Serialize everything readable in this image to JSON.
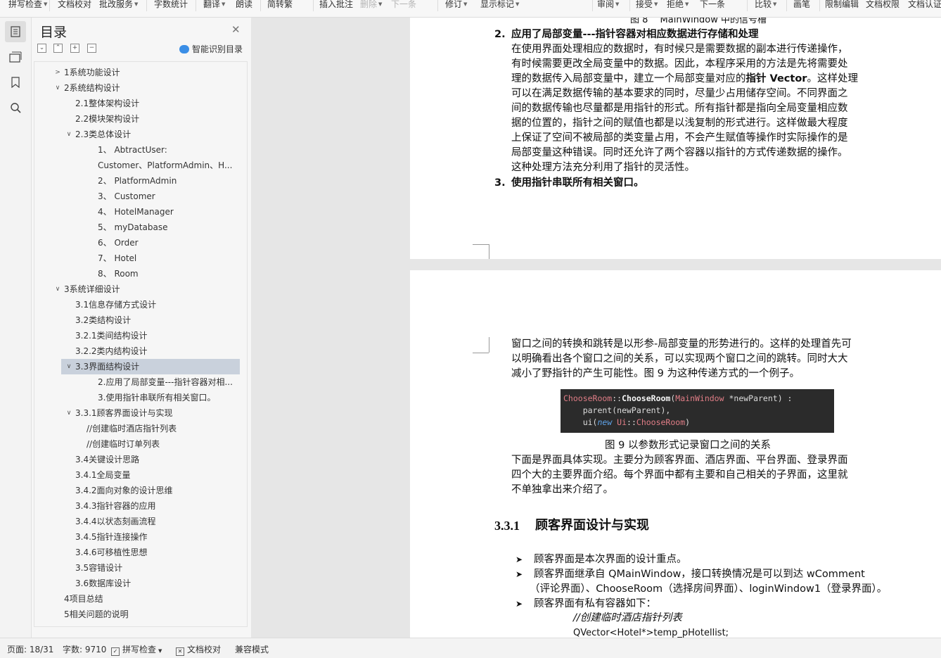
{
  "toolbar": {
    "items": [
      {
        "label": "拼写检查",
        "caret": true
      },
      {
        "label": "文档校对",
        "caret": false
      },
      {
        "label": "批改服务",
        "caret": true
      },
      {
        "label": "字数统计",
        "caret": false
      },
      {
        "label": "翻译",
        "caret": true
      },
      {
        "label": "朗读",
        "caret": false
      },
      {
        "label": "简转繁",
        "caret": false
      },
      {
        "label": "插入批注",
        "caret": false
      },
      {
        "label": "删除",
        "caret": true
      },
      {
        "label": "下一条",
        "caret": false
      },
      {
        "label": "修订",
        "caret": true
      },
      {
        "label": "显示标记",
        "caret": true
      },
      {
        "label": "审阅",
        "caret": true
      },
      {
        "label": "接受",
        "caret": true
      },
      {
        "label": "拒绝",
        "caret": true
      },
      {
        "label": "下一条",
        "caret": false
      },
      {
        "label": "比较",
        "caret": true
      },
      {
        "label": "画笔",
        "caret": false
      },
      {
        "label": "限制编辑",
        "caret": false
      },
      {
        "label": "文档权限",
        "caret": false
      },
      {
        "label": "文档认证",
        "caret": false
      }
    ]
  },
  "toc": {
    "title": "目录",
    "smart_label": "智能识别目录",
    "items": [
      {
        "label": "1系统功能设计",
        "arrow": "right"
      },
      {
        "label": "2系统结构设计",
        "arrow": "down"
      },
      {
        "label": "2.1整体架构设计",
        "arrow": ""
      },
      {
        "label": "2.2模块架构设计",
        "arrow": ""
      },
      {
        "label": "2.3类总体设计",
        "arrow": "down"
      },
      {
        "label": "1、 AbtractUser:",
        "arrow": ""
      },
      {
        "label": "Customer、PlatformAdmin、H...",
        "arrow": ""
      },
      {
        "label": "2、 PlatformAdmin",
        "arrow": ""
      },
      {
        "label": "3、 Customer",
        "arrow": ""
      },
      {
        "label": "4、 HotelManager",
        "arrow": ""
      },
      {
        "label": "5、 myDatabase",
        "arrow": ""
      },
      {
        "label": "6、 Order",
        "arrow": ""
      },
      {
        "label": "7、 Hotel",
        "arrow": ""
      },
      {
        "label": "8、 Room",
        "arrow": ""
      },
      {
        "label": "3系统详细设计",
        "arrow": "down"
      },
      {
        "label": "3.1信息存储方式设计",
        "arrow": ""
      },
      {
        "label": "3.2类结构设计",
        "arrow": ""
      },
      {
        "label": "3.2.1类间结构设计",
        "arrow": ""
      },
      {
        "label": "3.2.2类内结构设计",
        "arrow": ""
      },
      {
        "label": "3.3界面结构设计",
        "arrow": "down"
      },
      {
        "label": "2.应用了局部变量---指针容器对相...",
        "arrow": ""
      },
      {
        "label": "3.使用指针串联所有相关窗口。",
        "arrow": ""
      },
      {
        "label": "3.3.1顾客界面设计与实现",
        "arrow": "down"
      },
      {
        "label": "//创建临时酒店指针列表",
        "arrow": ""
      },
      {
        "label": "//创建临时订单列表",
        "arrow": ""
      },
      {
        "label": "3.4关键设计思路",
        "arrow": ""
      },
      {
        "label": "3.4.1全局变量",
        "arrow": ""
      },
      {
        "label": "3.4.2面向对象的设计思维",
        "arrow": ""
      },
      {
        "label": "3.4.3指针容器的应用",
        "arrow": ""
      },
      {
        "label": "3.4.4以状态刻画流程",
        "arrow": ""
      },
      {
        "label": "3.4.5指针连接操作",
        "arrow": ""
      },
      {
        "label": "3.4.6可移植性思想",
        "arrow": ""
      },
      {
        "label": "3.5容错设计",
        "arrow": ""
      },
      {
        "label": "3.6数据库设计",
        "arrow": ""
      },
      {
        "label": "4项目总结",
        "arrow": ""
      },
      {
        "label": "5相关问题的说明",
        "arrow": ""
      }
    ]
  },
  "doc": {
    "page1": {
      "caption_top": "图 8 　MainWindow 中的信号槽",
      "item2_num": "2.",
      "item2_title": "应用了局部变量---指针容器对相应数据进行存储和处理",
      "para_lines": [
        "在使用界面处理相应的数据时，有时候只是需要数据的副本进行传递操作，",
        "有时候需要更改全局变量中的数据。因此，本程序采用的方法是先将需要处",
        "理的数据传入局部变量中，建立一个局部变量对应的",
        "可以在满足数据传输的基本要求的同时，尽量少占用储存空间。不同界面之",
        "间的数据传输也尽量都是用指针的形式。所有指针都是指向全局变量相应数",
        "据的位置的，指针之间的赋值也都是以浅复制的形式进行。这样做最大程度",
        "上保证了空间不被局部的类变量占用，不会产生赋值等操作时实际操作的是",
        "局部变量这种错误。同时还允许了两个容器以指针的方式传递数据的操作。",
        "这种处理方法充分利用了指针的灵活性。"
      ],
      "para_line3_bold": "指针 Vector",
      "para_line3_tail": "。这样处理",
      "item3_num": "3.",
      "item3_title": "使用指针串联所有相关窗口。"
    },
    "page2": {
      "para1_lines": [
        "窗口之间的转换和跳转是以形参-局部变量的形势进行的。这样的处理首先可",
        "以明确看出各个窗口之间的关系，可以实现两个窗口之间的跳转。同时大大",
        "减小了野指针的产生可能性。图 9 为这种传递方式的一个例子。"
      ],
      "code": {
        "l1_a": "ChooseRoom",
        "l1_b": "::",
        "l1_c": "ChooseRoom",
        "l1_d": "(",
        "l1_e": "MainWindow",
        "l1_f": " *newParent) :",
        "l2": "    parent(newParent),",
        "l3_a": "    ui(",
        "l3_b": "new",
        "l3_c": " Ui",
        "l3_d": "::",
        "l3_e": "ChooseRoom",
        "l3_f": ")"
      },
      "caption": "图 9 以参数形式记录窗口之间的关系",
      "para2_lines": [
        "下面是界面具体实现。主要分为顾客界面、酒店界面、平台界面、登录界面",
        "四个大的主要界面介绍。每个界面中都有主要和自己相关的子界面，这里就",
        "不单独拿出来介绍了。"
      ],
      "heading_num": "3.3.1",
      "heading_text": "顾客界面设计与实现",
      "bullets": [
        "顾客界面是本次界面的设计重点。",
        "顾客界面继承自 QMainWindow，接口转换情况是可以到达 wComment",
        "（评论界面）、ChooseRoom（选择房间界面）、loginWindow1（登录界面）。",
        "顾客界面有私有容器如下："
      ],
      "comment_line": "//创建临时酒店指针列表",
      "code_line": "QVector<Hotel*>temp_pHotellist;"
    }
  },
  "status": {
    "page": "页面: 18/31",
    "words": "字数: 9710",
    "spell": "拼写检查",
    "proof": "文档校对",
    "compat": "兼容模式"
  }
}
